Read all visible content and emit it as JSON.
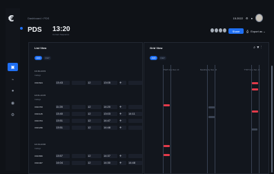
{
  "header": {
    "breadcrumb": "Dashboard  ›  PDS",
    "title": "PDS",
    "clock": "13:20",
    "clock_sub": "Current Sequence",
    "date": "15.2022",
    "share_label": "Share",
    "export_label": "Export as ⌄"
  },
  "list": {
    "title": "List View",
    "pill_on": "ARR",
    "pill_off": "DEP",
    "sections": [
      {
        "label": "13:46-14:03",
        "rows": [
          {
            "id": "CMC624",
            "v": [
              "13:43",
              "",
              "12",
              "13:05",
              "✈",
              ""
            ]
          }
        ]
      },
      {
        "label": "14:01-14:15",
        "rows": [
          {
            "id": "CMC700",
            "v": [
              "11:28",
              "",
              "12",
              "14:20",
              "✈",
              ""
            ]
          },
          {
            "id": "CMC145",
            "v": [
              "13:40",
              "",
              "12",
              "13:03",
              "✈",
              "14:11"
            ]
          },
          {
            "id": "CMC764",
            "v": [
              "13:51",
              "",
              "12",
              "14:47",
              "✈",
              ""
            ]
          },
          {
            "id": "CMC236",
            "v": [
              "13:51",
              "",
              "12",
              "14:48",
              "✈",
              ""
            ]
          }
        ]
      },
      {
        "label": "14:16-14:30",
        "rows": [
          {
            "id": "CMC836",
            "v": [
              "13:57",
              "",
              "12",
              "14:37",
              "✈",
              ""
            ]
          },
          {
            "id": "CMC467",
            "v": [
              "14:04",
              "",
              "12",
              "14:30",
              "✈",
              "14:48"
            ]
          }
        ]
      }
    ],
    "headers": [
      "Callsign",
      "Cetd",
      "Cept",
      "Spot",
      "Ctot",
      "Eobt"
    ]
  },
  "grid": {
    "title": "Grid View",
    "pill_on": "ARR",
    "pill_off": "DEP",
    "columns": [
      "TSAT time Sat, 10",
      "Standing by Sat, 10",
      "TTOT time Sat, 10"
    ]
  },
  "colors": {
    "accent": "#1f6ff2",
    "alert": "#e23a4a"
  }
}
